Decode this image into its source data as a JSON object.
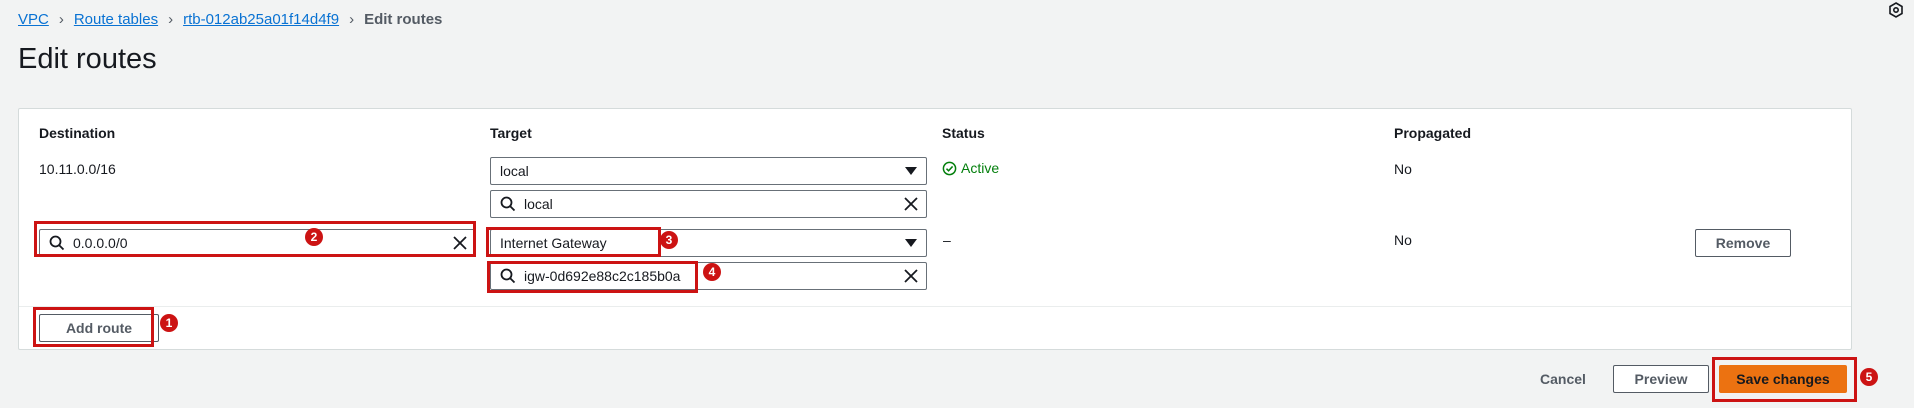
{
  "breadcrumb": {
    "items": [
      "VPC",
      "Route tables",
      "rtb-012ab25a01f14d4f9"
    ],
    "current": "Edit routes"
  },
  "page_title": "Edit routes",
  "table": {
    "columns": [
      "Destination",
      "Target",
      "Status",
      "Propagated"
    ],
    "rows": [
      {
        "destination": "10.11.0.0/16",
        "target_type": "local",
        "target_value": "local",
        "status": "Active",
        "propagated": "No"
      },
      {
        "destination": "0.0.0.0/0",
        "target_type": "Internet Gateway",
        "target_value": "igw-0d692e88c2c185b0a",
        "status": "–",
        "propagated": "No",
        "remove_label": "Remove"
      }
    ]
  },
  "add_route_label": "Add route",
  "footer": {
    "cancel_label": "Cancel",
    "preview_label": "Preview",
    "save_label": "Save changes"
  },
  "annotations": [
    "1",
    "2",
    "3",
    "4",
    "5"
  ],
  "colors": {
    "accent": "#cc1313",
    "primary_button": "#ec7211",
    "link": "#0972d3",
    "status_active": "#037f0c"
  }
}
